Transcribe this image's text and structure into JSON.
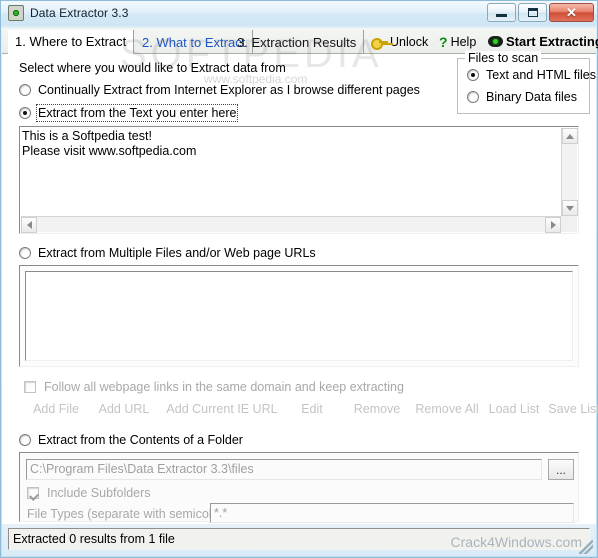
{
  "window": {
    "title": "Data Extractor 3.3",
    "app_icon": "eye-icon",
    "buttons": {
      "minimize": "minimize-button",
      "maximize": "maximize-button",
      "close": "✕"
    }
  },
  "tabs": [
    {
      "label": "1. Where to Extract",
      "state": "active"
    },
    {
      "label": "2. What to Extract",
      "state": "link"
    },
    {
      "label": "3. Extraction Results",
      "state": "normal"
    }
  ],
  "toolbar": [
    {
      "label": "Unlock",
      "icon": "key-icon"
    },
    {
      "label": "Help",
      "icon": "question-mark-icon"
    },
    {
      "label": "Start Extracting",
      "icon": "eye-icon"
    }
  ],
  "main": {
    "prompt": "Select where you would like to Extract data from",
    "source_options": [
      {
        "label": "Continually Extract from Internet Explorer as I browse different pages",
        "selected": false
      },
      {
        "label": "Extract from the Text you enter here",
        "selected": true,
        "focused": true
      },
      {
        "label": "Extract from Multiple Files and/or Web page URLs",
        "selected": false
      },
      {
        "label": "Extract from the Contents of a Folder",
        "selected": false
      }
    ],
    "text_input": "This is a Softpedia test!\nPlease visit www.softpedia.com",
    "urls_list": "",
    "follow_links": {
      "label": "Follow all webpage links in the same domain and keep extracting",
      "checked": false,
      "enabled": false
    },
    "list_buttons": [
      "Add File",
      "Add URL",
      "Add Current IE URL",
      "Edit",
      "Remove",
      "Remove All",
      "Load List",
      "Save List"
    ],
    "folder_path": "C:\\Program Files\\Data Extractor 3.3\\files",
    "browse_button": "...",
    "include_subfolders": {
      "label": "Include Subfolders",
      "checked": true,
      "enabled": false
    },
    "file_types_label": "File Types (separate with semicolons)",
    "file_types_value": "*.*"
  },
  "files_to_scan": {
    "title": "Files to scan",
    "options": [
      {
        "label": "Text and HTML files",
        "selected": true
      },
      {
        "label": "Binary Data files",
        "selected": false
      }
    ]
  },
  "status": {
    "text": "Extracted 0 results from 1 file"
  },
  "watermarks": {
    "big": "SOFTPEDIA",
    "small": "www.softpedia.com",
    "corner": "Crack4Windows.com"
  }
}
